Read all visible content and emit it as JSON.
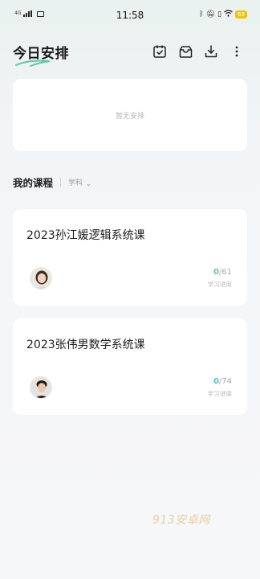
{
  "status_bar": {
    "network": "4G",
    "time": "11:58",
    "battery": "69"
  },
  "header": {
    "title": "今日安排",
    "icons": [
      "calendar-check-icon",
      "box-icon",
      "download-icon",
      "more-vertical-icon"
    ]
  },
  "schedule": {
    "empty_text": "暂无安排"
  },
  "courses_section": {
    "title": "我的课程",
    "filter_label": "学科"
  },
  "courses": [
    {
      "title": "2023孙江媛逻辑系统课",
      "progress_done": "0",
      "progress_total": "/61",
      "progress_label": "学习进度"
    },
    {
      "title": "2023张伟男数学系统课",
      "progress_done": "0",
      "progress_total": "/74",
      "progress_label": "学习进度"
    }
  ],
  "watermark": "913安卓网",
  "colors": {
    "accent": "#4fc9b0",
    "swoosh": "#5cc9a7",
    "background": "#f5f6f8"
  }
}
